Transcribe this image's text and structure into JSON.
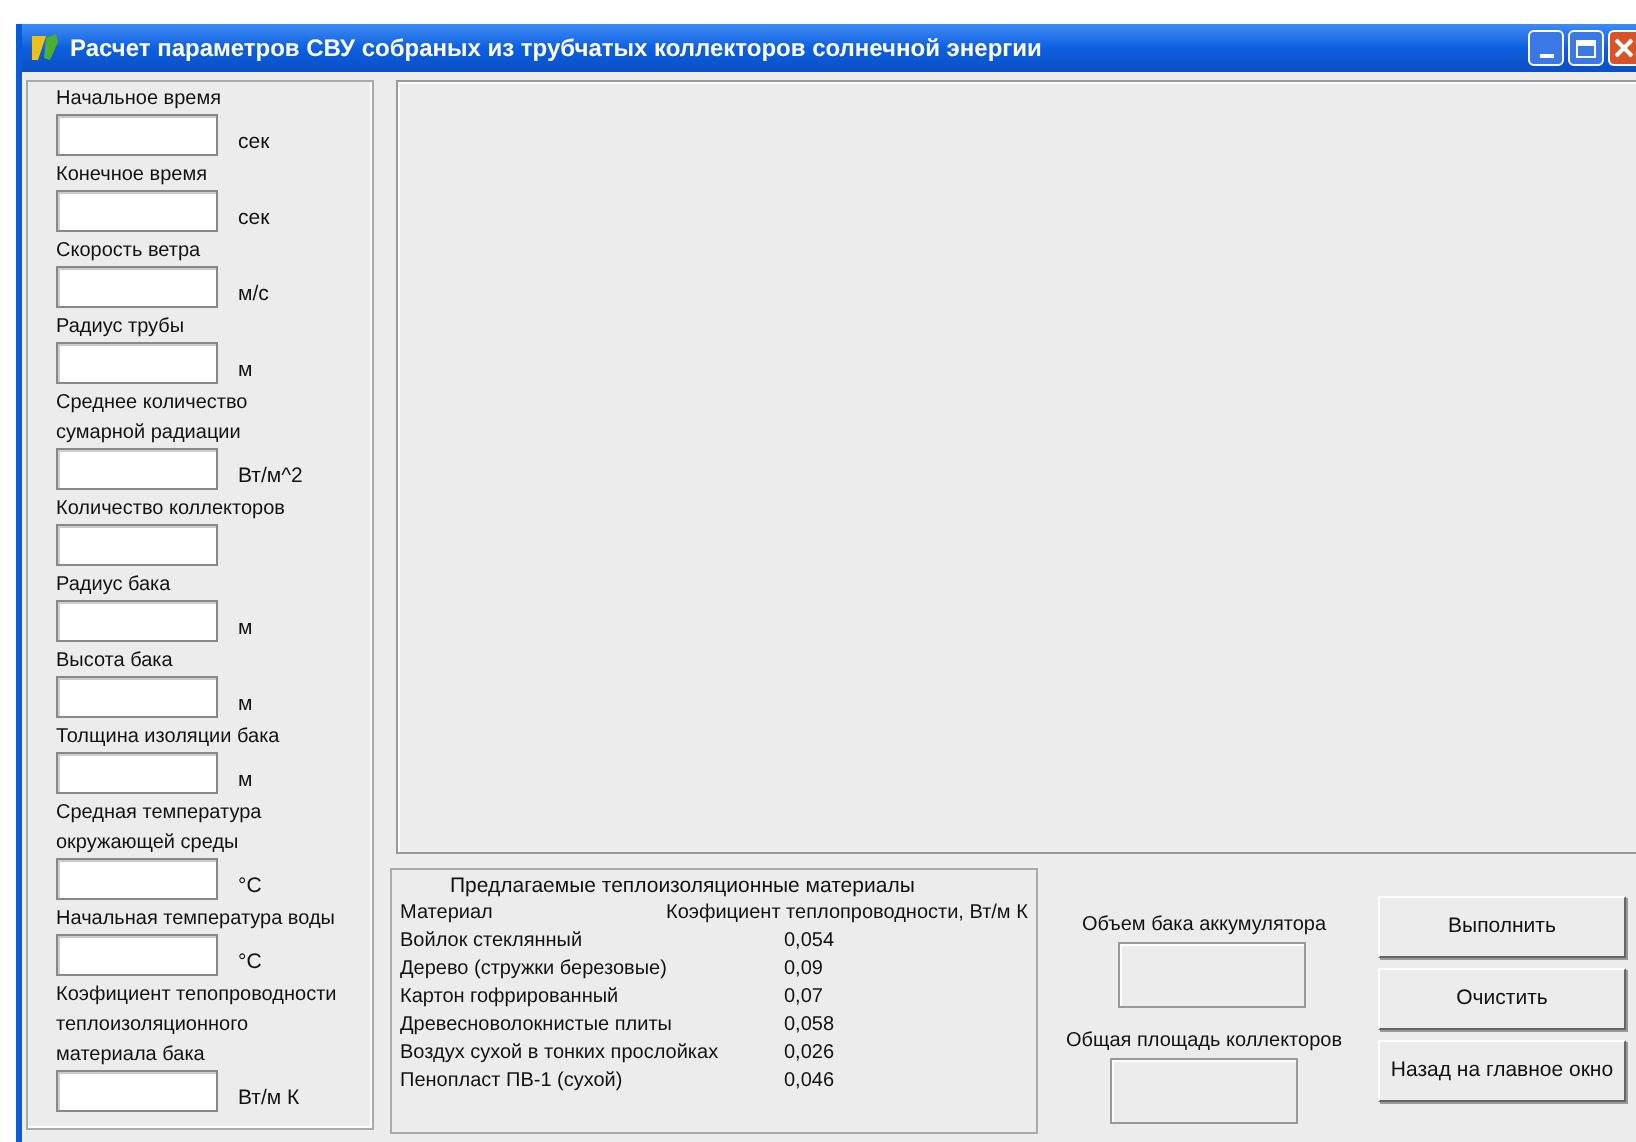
{
  "window": {
    "title": "Расчет параметров СВУ собраных из трубчатых коллекторов солнечной энергии"
  },
  "inputs": [
    {
      "label_lines": [
        "Начальное время"
      ],
      "unit": "сек"
    },
    {
      "label_lines": [
        "Конечное время"
      ],
      "unit": "сек"
    },
    {
      "label_lines": [
        "Скорость ветра"
      ],
      "unit": "м/с"
    },
    {
      "label_lines": [
        "Радиус трубы"
      ],
      "unit": "м"
    },
    {
      "label_lines": [
        "Среднее количество",
        "сумарной радиации"
      ],
      "unit": "Вт/м^2"
    },
    {
      "label_lines": [
        "Количество коллекторов"
      ]
    },
    {
      "label_lines": [
        "Радиус бака"
      ],
      "unit": "м"
    },
    {
      "label_lines": [
        "Высота бака"
      ],
      "unit": "м"
    },
    {
      "label_lines": [
        "Толщина изоляции бака"
      ],
      "unit": "м"
    },
    {
      "label_lines": [
        "Средная температура",
        "окружающей среды"
      ],
      "unit": "°С"
    },
    {
      "label_lines": [
        "Начальная температура воды"
      ],
      "unit": "°С"
    },
    {
      "label_lines": [
        "Коэфициент тепопроводности",
        "теплоизоляционного",
        "материала бака"
      ],
      "unit": "Вт/м К"
    }
  ],
  "materials_table": {
    "title": "Предлагаемые теплоизоляционные материалы",
    "columns": [
      "Материал",
      "Коэфициент теплопроводности, Вт/м К"
    ],
    "rows": [
      [
        "Войлок стеклянный",
        "0,054"
      ],
      [
        "Дерево (стружки березовые)",
        "0,09"
      ],
      [
        "Картон гофрированный",
        "0,07"
      ],
      [
        "Древесноволокнистые плиты",
        "0,058"
      ],
      [
        "Воздух сухой в тонких прослойках",
        "0,026"
      ],
      [
        "Пенопласт ПВ-1 (сухой)",
        "0,046"
      ]
    ]
  },
  "outputs": [
    {
      "label": "Объем бака аккумулятора"
    },
    {
      "label": "Общая площадь коллекторов"
    }
  ],
  "buttons": [
    "Выполнить",
    "Очистить",
    "Назад на главное окно"
  ]
}
